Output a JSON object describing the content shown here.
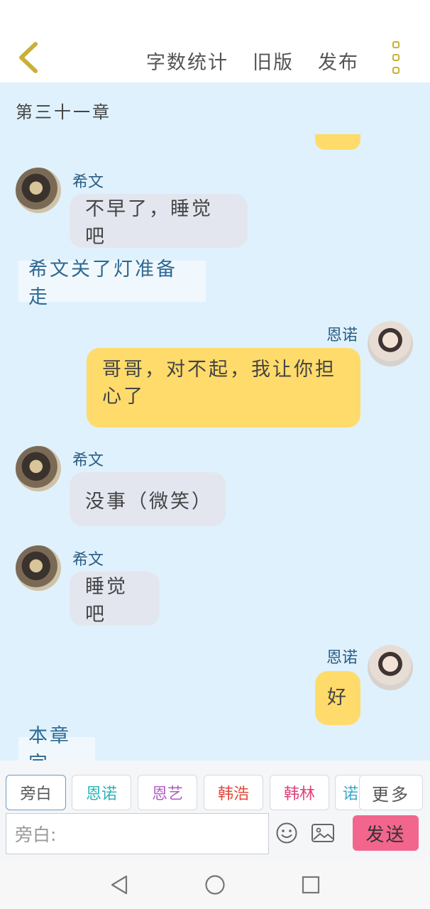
{
  "header": {
    "word_count_label": "字数统计",
    "old_version_label": "旧版",
    "publish_label": "发布"
  },
  "chat": {
    "chapter_title": "第三十一章",
    "messages": [
      {
        "sender": "希文",
        "text": "不早了，睡觉吧"
      },
      {
        "narration": "希文关了灯准备走"
      },
      {
        "sender": "恩诺",
        "text": "哥哥，对不起，我让你担心了"
      },
      {
        "sender": "希文",
        "text": "没事（微笑）"
      },
      {
        "sender": "希文",
        "text": "睡觉吧"
      },
      {
        "sender": "恩诺",
        "text": "好"
      },
      {
        "narration": "本章完"
      }
    ]
  },
  "roles": {
    "chips": [
      {
        "label": "旁白",
        "color": "#555555"
      },
      {
        "label": "恩诺",
        "color": "#2bb3b8"
      },
      {
        "label": "恩艺",
        "color": "#b15fc4"
      },
      {
        "label": "韩浩",
        "color": "#e2493c"
      },
      {
        "label": "韩林",
        "color": "#e0417a"
      },
      {
        "label": "诺",
        "color": "#3aa9c9"
      }
    ],
    "more_label": "更多"
  },
  "composer": {
    "placeholder": "旁白:",
    "send_label": "发送"
  }
}
